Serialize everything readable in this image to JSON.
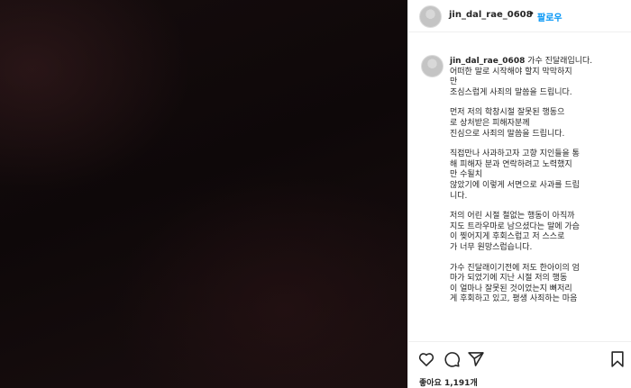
{
  "post": {
    "username": "jin_dal_rae_0608",
    "separator": "•",
    "follow_label": "팔로우"
  },
  "caption": {
    "username": "jin_dal_rae_0608",
    "first_line": " 가수 진달래입니다.\n어떠한 말로 시작해야 할지 막막하지\n만\n조심스럽게 사죄의 말씀을 드립니다.",
    "paragraphs": [
      "먼저 저의 학창시절 잘못된 행동으\n로 상처받은 피해자분께\n진심으로 사죄의 말씀을 드립니다.",
      "직접만나 사과하고자 고향 지인들을 통\n해 피해자 분과 연락하려고 노력했지\n만 수될치\n않았기에 이렇게 서면으로 사과를 드립\n니다.",
      "저의 어린 시절 철없는 행동이 아직까\n지도 트라우마로 남으셨다는 말에 가슴\n이 찢어지게 후회스럽고 저 스스로\n가 너무 원망스럽습니다.",
      "가수 진달래이기전에 저도 한아이의 엄\n마가 되었기에 지난 시절 저의 행동\n이 얼마나 잘못된 것이었는지 뼈저리\n게 후회하고 있고, 평생 사죄하는 마음"
    ]
  },
  "actions": {
    "likes_text": "좋아요 1,191개"
  },
  "icons": {
    "like": "heart-icon",
    "comment": "comment-icon",
    "share": "share-icon",
    "save": "bookmark-icon"
  }
}
